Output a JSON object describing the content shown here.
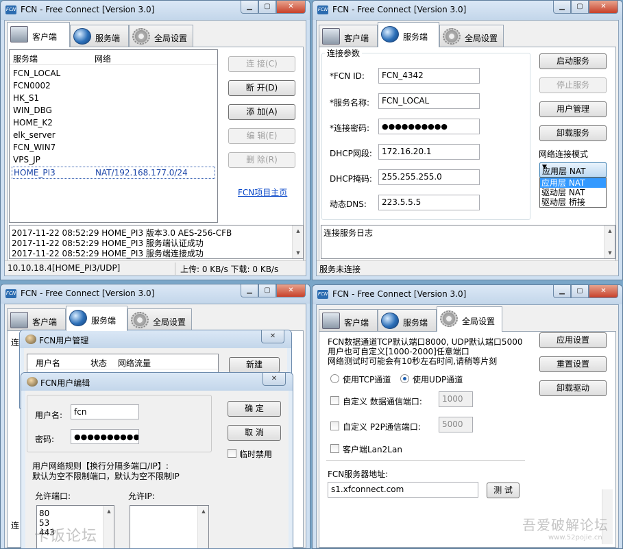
{
  "shared": {
    "title": "FCN - Free Connect [Version 3.0]",
    "tab_client": "客户端",
    "tab_server": "服务端",
    "tab_global": "全局设置",
    "app_icon": "FCN",
    "min_glyph": "▁",
    "max_glyph": "▢",
    "close_glyph": "✕"
  },
  "client_win": {
    "col_server": "服务端",
    "col_network": "网络",
    "servers": [
      {
        "name": "FCN_LOCAL",
        "network": ""
      },
      {
        "name": "FCN0002",
        "network": ""
      },
      {
        "name": "HK_S1",
        "network": ""
      },
      {
        "name": "WIN_DBG",
        "network": ""
      },
      {
        "name": "HOME_K2",
        "network": ""
      },
      {
        "name": "elk_server",
        "network": ""
      },
      {
        "name": "FCN_WIN7",
        "network": ""
      },
      {
        "name": "VPS_JP",
        "network": ""
      },
      {
        "name": "HOME_PI3",
        "network": "NAT/192.168.177.0/24"
      }
    ],
    "btn_connect": "连 接(C)",
    "btn_disconnect": "断 开(D)",
    "btn_add": "添 加(A)",
    "btn_edit": "编 辑(E)",
    "btn_delete": "删 除(R)",
    "link_home": "FCN项目主页",
    "log": [
      "2017-11-22 08:52:29 HOME_PI3 版本3.0 AES-256-CFB",
      "2017-11-22 08:52:29 HOME_PI3 服务端认证成功",
      "2017-11-22 08:52:29 HOME_PI3 服务端连接成功"
    ],
    "status_left": "10.10.18.4[HOME_PI3/UDP]",
    "status_right": "上传: 0  KB/s 下载: 0  KB/s"
  },
  "server_win": {
    "group_title": "连接参数",
    "lbl_id": "*FCN ID:",
    "val_id": "FCN_4342",
    "lbl_name": "*服务名称:",
    "val_name": "FCN_LOCAL",
    "lbl_pwd": "*连接密码:",
    "val_pwd": "●●●●●●●●●●",
    "lbl_dhcp": "DHCP网段:",
    "val_dhcp": "172.16.20.1",
    "lbl_mask": "DHCP掩码:",
    "val_mask": "255.255.255.0",
    "lbl_dns": "动态DNS:",
    "val_dns": "223.5.5.5",
    "btn_start": "启动服务",
    "btn_stop": "停止服务",
    "btn_users": "用户管理",
    "btn_uninstall": "卸载服务",
    "mode_label": "网络连接模式",
    "mode_selected": "应用层 NAT",
    "mode_options": [
      "应用层 NAT",
      "驱动层 NAT",
      "驱动层 桥接"
    ],
    "log_text": "连接服务日志",
    "status": "服务未连接"
  },
  "users_win": {
    "partial_label": "连",
    "partial_bottom": "连",
    "dlg_manage_title": "FCN用户管理",
    "col_user": "用户名",
    "col_state": "状态",
    "col_traffic": "网络流量",
    "btn_new": "新建",
    "dlg_edit_title": "FCN用户编辑",
    "lbl_username": "用户名:",
    "val_username": "fcn",
    "lbl_password": "密码:",
    "val_password": "●●●●●●●●●●",
    "btn_ok": "确 定",
    "btn_cancel": "取 消",
    "chk_disable": "临时禁用",
    "rule_line1": "用户网络规则【换行分隔多端口/IP】:",
    "rule_line2": "默认为空不限制端口，默认为空不限制IP",
    "lbl_ports": "允许端口:",
    "lbl_ips": "允许IP:",
    "ports": [
      "80",
      "53",
      "443"
    ]
  },
  "global_win": {
    "info_line1": "FCN数据通道TCP默认端口8000, UDP默认端口5000",
    "info_line2": "用户也可自定义[1000-2000]任意端口",
    "info_line3": "网络测试时可能会有10秒左右时间,请稍等片刻",
    "radio_tcp": "使用TCP通道",
    "radio_udp": "使用UDP通道",
    "chk_data_port": "自定义  数据通信端口:",
    "val_data_port": "1000",
    "chk_p2p_port": "自定义  P2P通信端口:",
    "val_p2p_port": "5000",
    "chk_lan": "客户端Lan2Lan",
    "lbl_server_addr": "FCN服务器地址:",
    "val_server_addr": "s1.xfconnect.com",
    "btn_test": "测 试",
    "btn_apply": "应用设置",
    "btn_reset": "重置设置",
    "btn_uninstall_driver": "卸载驱动"
  },
  "watermarks": {
    "left": "卡饭论坛",
    "right": "吾爱破解论坛",
    "right_url": "www.52pojie.cn"
  }
}
